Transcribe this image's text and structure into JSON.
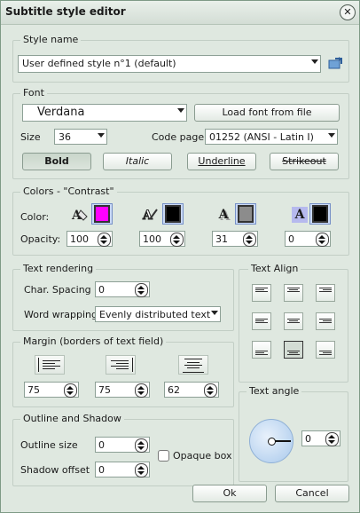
{
  "window": {
    "title": "Subtitle style editor"
  },
  "style_name": {
    "group_label": "Style name",
    "selected": "User defined style n°1 (default)"
  },
  "font": {
    "group_label": "Font",
    "family": "Verdana",
    "load_button": "Load font from file",
    "size_label": "Size",
    "size_value": "36",
    "codepage_label": "Code page",
    "codepage_value": "01252 (ANSI - Latin I)",
    "bold": "Bold",
    "italic": "Italic",
    "underline": "Underline",
    "strikeout": "Strikeout"
  },
  "colors": {
    "group_label": "Colors - \"Contrast\"",
    "color_label": "Color:",
    "opacity_label": "Opacity:",
    "swatches": [
      "#ff00ff",
      "#000000",
      "#8c8c8c",
      "#000000"
    ],
    "opacities": [
      "100",
      "100",
      "31",
      "0"
    ]
  },
  "text_rendering": {
    "group_label": "Text rendering",
    "char_spacing_label": "Char. Spacing",
    "char_spacing_value": "0",
    "word_wrapping_label": "Word wrapping",
    "word_wrapping_value": "Evenly distributed text"
  },
  "text_align": {
    "group_label": "Text Align",
    "selected": "bottom-center"
  },
  "margin": {
    "group_label": "Margin  (borders of text field)",
    "values": [
      "75",
      "75",
      "62"
    ]
  },
  "outline": {
    "group_label": "Outline  and Shadow",
    "outline_size_label": "Outline size",
    "outline_size_value": "0",
    "shadow_offset_label": "Shadow offset",
    "shadow_offset_value": "0",
    "opaque_box_label": "Opaque box"
  },
  "text_angle": {
    "group_label": "Text angle",
    "value": "0"
  },
  "buttons": {
    "ok": "Ok",
    "cancel": "Cancel"
  }
}
